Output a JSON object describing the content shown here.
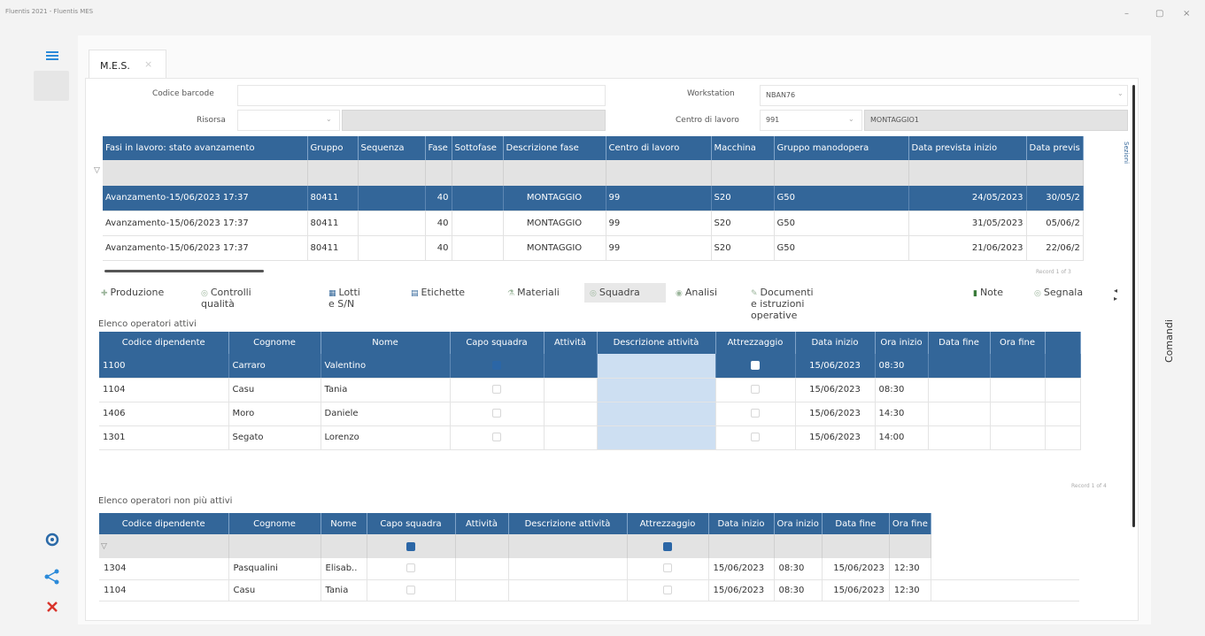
{
  "window": {
    "title": "Fluentis 2021 - Fluentis MES",
    "min": "–",
    "max": "▢",
    "close": "×"
  },
  "tab": {
    "label": "M.E.S.",
    "close": "×"
  },
  "form": {
    "barcode_label": "Codice barcode",
    "barcode_value": "",
    "risorsa_label": "Risorsa",
    "risorsa_value": "",
    "risorsa_desc": "",
    "workstation_label": "Workstation",
    "workstation_value": "NBAN76",
    "centro_label": "Centro di lavoro",
    "centro_value": "991",
    "centro_desc": "MONTAGGIO1"
  },
  "fasi": {
    "columns": [
      "Fasi in lavoro: stato avanzamento",
      "Gruppo",
      "Sequenza",
      "Fase",
      "Sottofase",
      "Descrizione fase",
      "Centro di lavoro",
      "Macchina",
      "Gruppo manodopera",
      "Data prevista inizio",
      "Data previs"
    ],
    "side_label": "Sezioni",
    "rows": [
      [
        "Avanzamento-15/06/2023 17:37",
        "80411",
        "",
        "40",
        "",
        "MONTAGGIO",
        "99",
        "S20",
        "G50",
        "24/05/2023",
        "30/05/2"
      ],
      [
        "Avanzamento-15/06/2023 17:37",
        "80411",
        "",
        "40",
        "",
        "MONTAGGIO",
        "99",
        "S20",
        "G50",
        "31/05/2023",
        "05/06/2"
      ],
      [
        "Avanzamento-15/06/2023 17:37",
        "80411",
        "",
        "40",
        "",
        "MONTAGGIO",
        "99",
        "S20",
        "G50",
        "21/06/2023",
        "22/06/2"
      ]
    ],
    "record": "Record 1 of 3"
  },
  "tabs": [
    {
      "label": "Produzione",
      "icon": "production-icon"
    },
    {
      "label": "Controlli qualità",
      "icon": "quality-icon"
    },
    {
      "label": "Lotti e S/N",
      "icon": "lots-icon"
    },
    {
      "label": "Etichette",
      "icon": "labels-icon"
    },
    {
      "label": "Materiali",
      "icon": "materials-icon"
    },
    {
      "label": "Squadra",
      "icon": "team-icon"
    },
    {
      "label": "Analisi",
      "icon": "analysis-icon"
    },
    {
      "label": "Documenti e istruzioni operative",
      "icon": "documents-icon"
    },
    {
      "label": "Note",
      "icon": "notes-icon"
    },
    {
      "label": "Segnala",
      "icon": "report-icon"
    }
  ],
  "attivi": {
    "title": "Elenco operatori attivi",
    "columns": [
      "Codice dipendente",
      "Cognome",
      "Nome",
      "Capo squadra",
      "Attività",
      "Descrizione attività",
      "Attrezzaggio",
      "Data inizio",
      "Ora inizio",
      "Data fine",
      "Ora fine"
    ],
    "rows": [
      {
        "codice": "1100",
        "cognome": "Carraro",
        "nome": "Valentino",
        "capo": true,
        "attrezzaggio": true,
        "data_inizio": "15/06/2023",
        "ora_inizio": "08:30"
      },
      {
        "codice": "1104",
        "cognome": "Casu",
        "nome": "Tania",
        "capo": false,
        "attrezzaggio": false,
        "data_inizio": "15/06/2023",
        "ora_inizio": "08:30"
      },
      {
        "codice": "1406",
        "cognome": "Moro",
        "nome": "Daniele",
        "capo": false,
        "attrezzaggio": false,
        "data_inizio": "15/06/2023",
        "ora_inizio": "14:30"
      },
      {
        "codice": "1301",
        "cognome": "Segato",
        "nome": "Lorenzo",
        "capo": false,
        "attrezzaggio": false,
        "data_inizio": "15/06/2023",
        "ora_inizio": "14:00"
      }
    ],
    "record": "Record 1 of 4"
  },
  "non_attivi": {
    "title": "Elenco operatori non più attivi",
    "columns": [
      "Codice dipendente",
      "Cognome",
      "Nome",
      "Capo squadra",
      "Attività",
      "Descrizione attività",
      "Attrezzaggio",
      "Data inizio",
      "Ora inizio",
      "Data fine",
      "Ora fine"
    ],
    "rows": [
      {
        "codice": "1304",
        "cognome": "Pasqualini",
        "nome": "Elisab..",
        "data_inizio": "15/06/2023",
        "ora_inizio": "08:30",
        "data_fine": "15/06/2023",
        "ora_fine": "12:30"
      },
      {
        "codice": "1104",
        "cognome": "Casu",
        "nome": "Tania",
        "data_inizio": "15/06/2023",
        "ora_inizio": "08:30",
        "data_fine": "15/06/2023",
        "ora_fine": "12:30"
      }
    ]
  },
  "comandi": {
    "label": "Comandi"
  },
  "colors": {
    "header": "#336699",
    "selected": "#336699",
    "desc_col": "#cddff2",
    "checkbox_on": "#2b66a6",
    "close_red": "#d9342b",
    "accent_blue": "#2b8ad9"
  }
}
